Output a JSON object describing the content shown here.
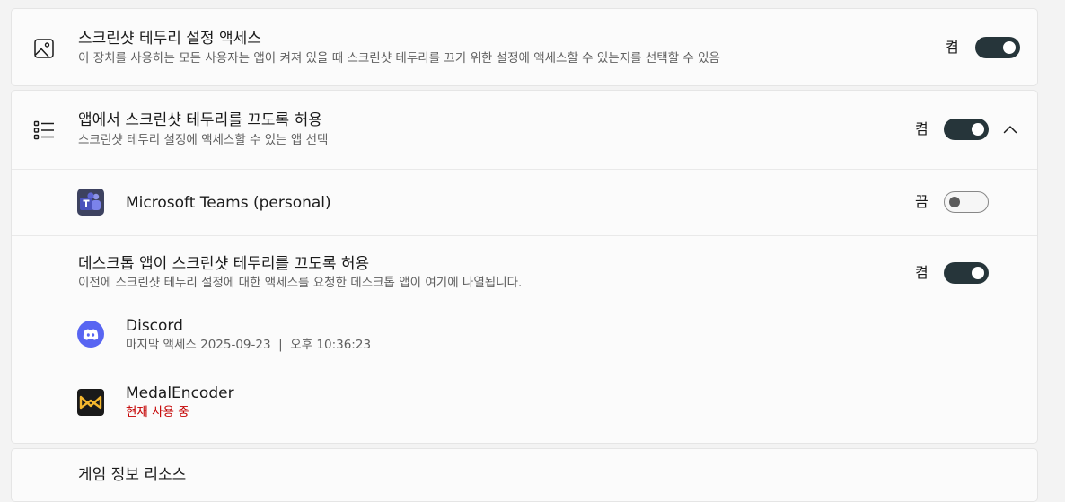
{
  "screenshot_access": {
    "title": "스크린샷 테두리 설정 액세스",
    "description": "이 장치를 사용하는 모든 사용자는 앱이 켜져 있을 때 스크린샷 테두리를 끄기 위한 설정에 액세스할 수 있는지를 선택할 수 있음",
    "state_label": "켬",
    "enabled": true
  },
  "apps_section": {
    "title": "앱에서 스크린샷 테두리를 끄도록 허용",
    "description": "스크린샷 테두리 설정에 액세스할 수 있는 앱 선택",
    "state_label": "켬",
    "enabled": true,
    "expanded": true,
    "apps": [
      {
        "name": "Microsoft Teams (personal)",
        "state_label": "끔",
        "enabled": false
      }
    ]
  },
  "desktop_section": {
    "title": "데스크톱 앱이 스크린샷 테두리를 끄도록 허용",
    "description": "이전에 스크린샷 테두리 설정에 대한 액세스를 요청한 데스크톱 앱이 여기에 나열됩니다.",
    "state_label": "켬",
    "enabled": true,
    "apps": [
      {
        "name": "Discord",
        "status": "마지막 액세스 2025-09-23  |  오후 10:36:23"
      },
      {
        "name": "MedalEncoder",
        "status": "현재 사용 중"
      }
    ]
  },
  "next_section": {
    "title": "게임 정보 리소스"
  },
  "colors": {
    "toggle_on": "#26353a",
    "in_use_status": "#c40000",
    "teams_brand": "#4b53bc",
    "discord_brand": "#5865f2",
    "medal_brand": "#f5b82e"
  },
  "icons": {
    "screenshot_access": "image-frame-icon",
    "apps_section": "list-icon",
    "expand": "chevron-up-icon",
    "teams": "teams-logo-icon",
    "discord": "discord-logo-icon",
    "medal": "medal-logo-icon"
  }
}
